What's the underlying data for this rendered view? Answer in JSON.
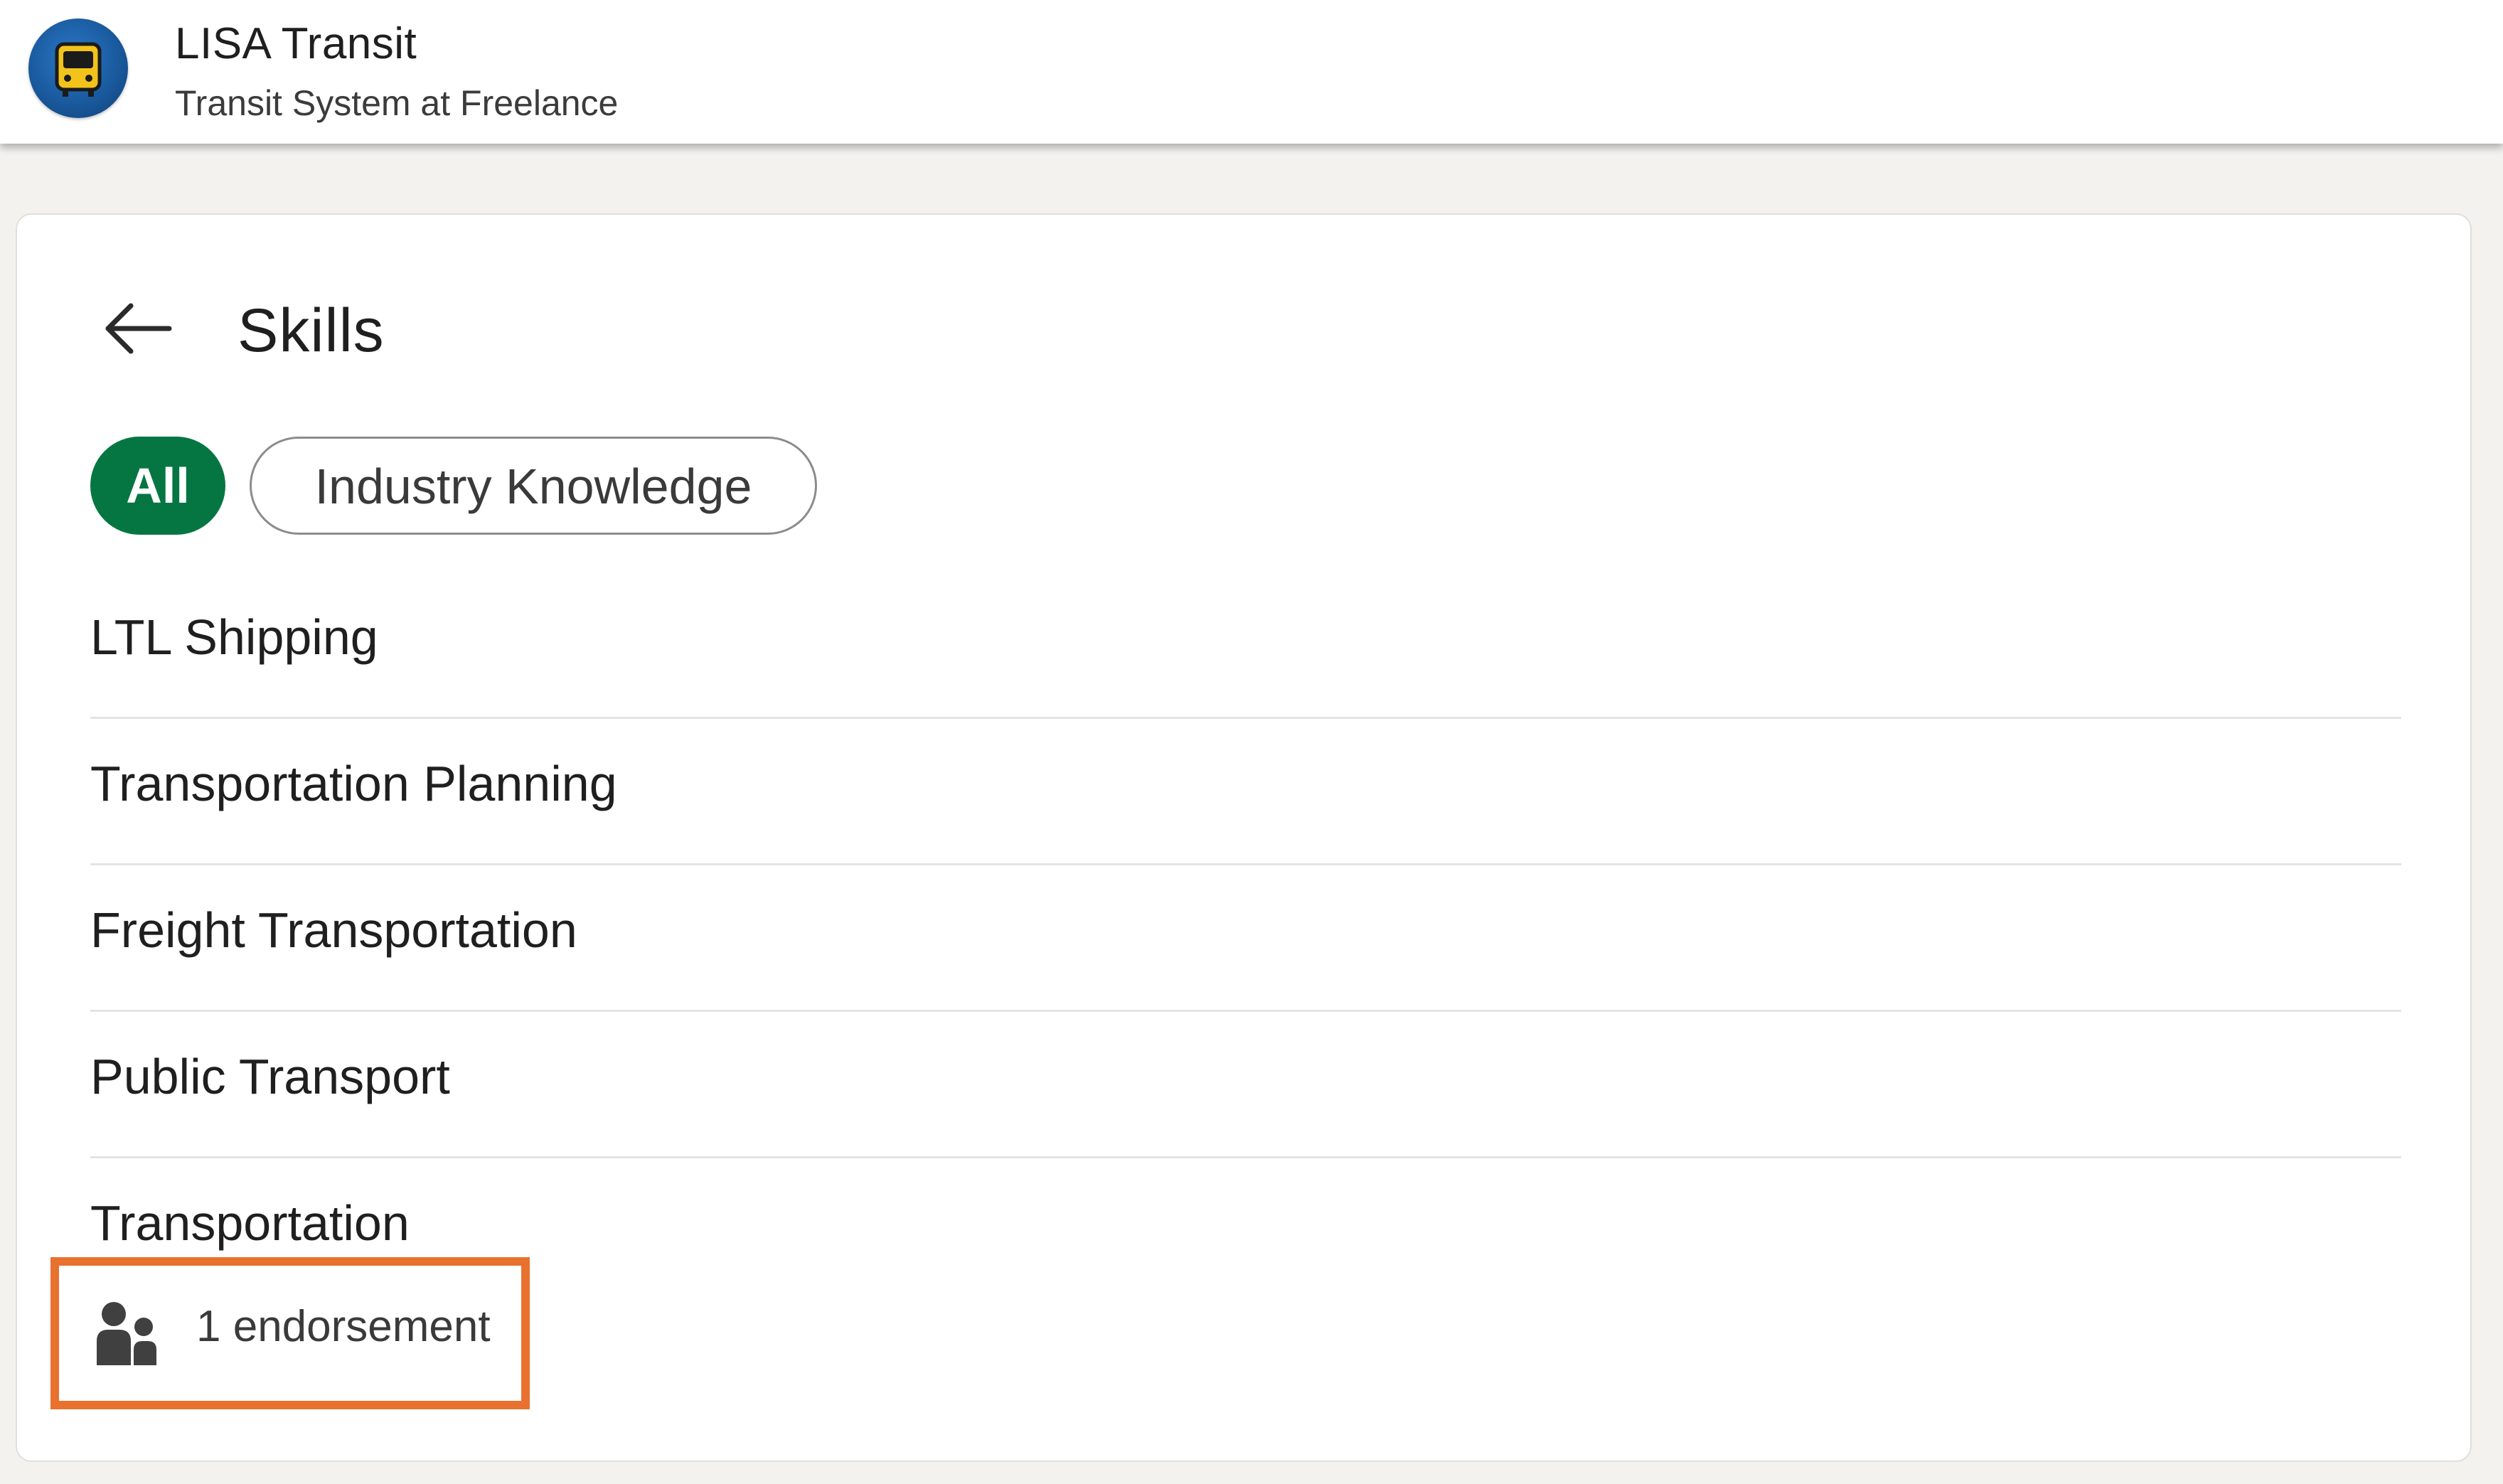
{
  "header": {
    "company_name": "LISA Transit",
    "company_subtitle": "Transit System at Freelance",
    "logo_icon": "transit-bus-logo-icon"
  },
  "page": {
    "title": "Skills",
    "back_icon": "arrow-left-icon"
  },
  "filters": {
    "items": [
      {
        "label": "All",
        "selected": true
      },
      {
        "label": "Industry Knowledge",
        "selected": false
      }
    ]
  },
  "skills": [
    {
      "name": "LTL Shipping"
    },
    {
      "name": "Transportation Planning"
    },
    {
      "name": "Freight Transportation"
    },
    {
      "name": "Public Transport"
    },
    {
      "name": "Transportation",
      "endorsement_text": "1 endorsement",
      "endorsement_icon": "people-icon"
    }
  ],
  "colors": {
    "accent_green": "#057642",
    "highlight_orange": "#e8712f",
    "background": "#f3f2ef"
  }
}
